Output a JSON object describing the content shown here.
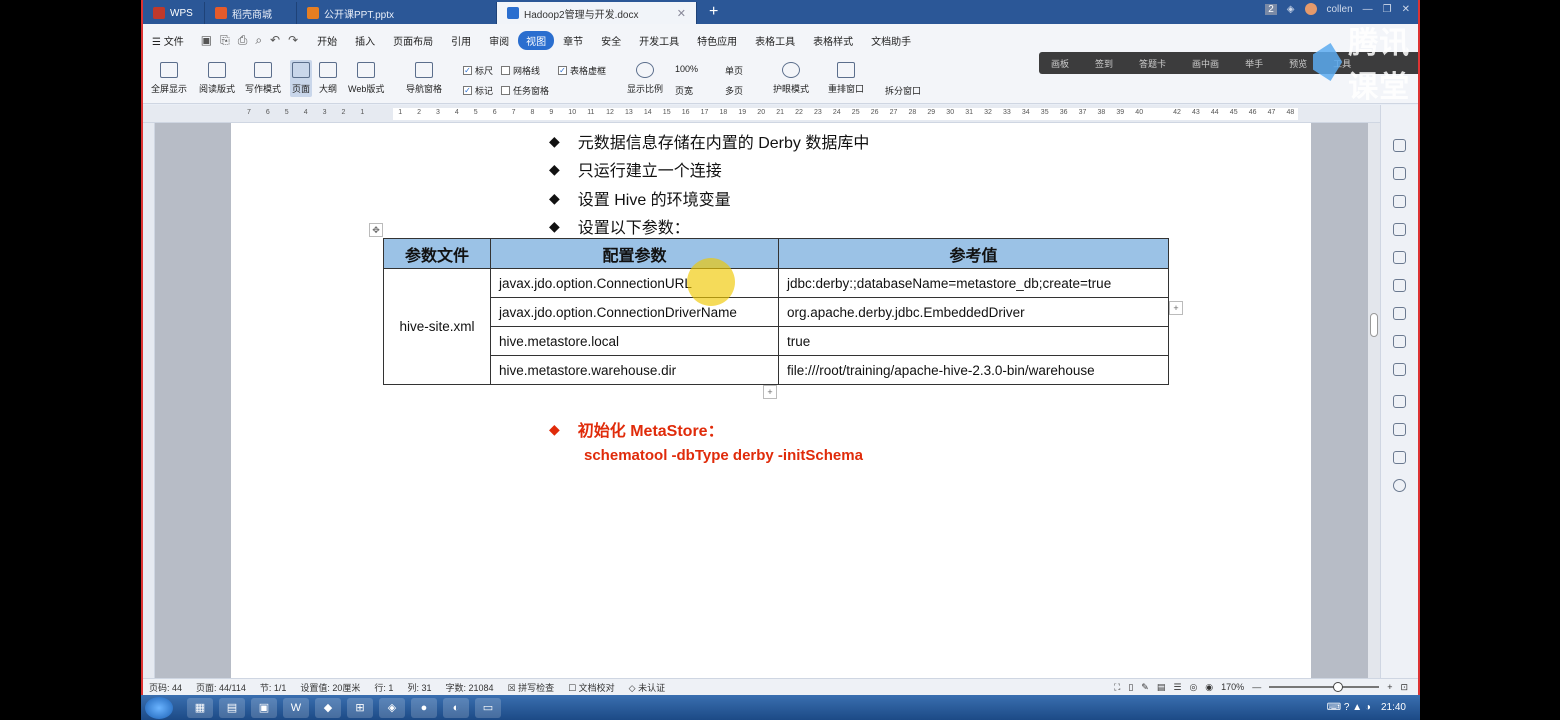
{
  "tabs": [
    {
      "label": "WPS",
      "color": "#c0392b"
    },
    {
      "label": "稻壳商城",
      "color": "#e55b2b"
    },
    {
      "label": "公开课PPT.pptx",
      "color": "#e67e22"
    },
    {
      "label": "Hadoop2管理与开发.docx",
      "color": "#2a6ecf"
    }
  ],
  "titlebar": {
    "badge": "2",
    "user": "collen"
  },
  "menu": {
    "file": "文件",
    "items": [
      "开始",
      "插入",
      "页面布局",
      "引用",
      "审阅",
      "视图",
      "章节",
      "安全",
      "开发工具",
      "特色应用",
      "表格工具",
      "表格样式",
      "文档助手"
    ],
    "selected": "视图"
  },
  "ribbon": {
    "buttons": [
      "全屏显示",
      "阅读版式",
      "写作模式",
      "页面",
      "大纲",
      "Web版式",
      "导航窗格",
      "显示比例",
      "护眼模式",
      "重排窗口",
      "拆分窗口"
    ],
    "checks": [
      {
        "label": "标尺",
        "checked": true
      },
      {
        "label": "网格线",
        "checked": false
      },
      {
        "label": "表格虚框",
        "checked": true
      },
      {
        "label": "标记",
        "checked": true
      },
      {
        "label": "任务窗格",
        "checked": false
      }
    ],
    "zoom100": "100%",
    "single": "单页",
    "pagewidth": "页宽",
    "multi": "多页"
  },
  "overlay": [
    "画板",
    "签到",
    "答题卡",
    "画中画",
    "举手",
    "预览",
    "工具"
  ],
  "brand": "腾讯课堂",
  "ruler_numbers": [
    "7",
    "6",
    "5",
    "4",
    "3",
    "2",
    "1",
    "",
    "1",
    "2",
    "3",
    "4",
    "5",
    "6",
    "7",
    "8",
    "9",
    "10",
    "11",
    "12",
    "13",
    "14",
    "15",
    "16",
    "17",
    "18",
    "19",
    "20",
    "21",
    "22",
    "23",
    "24",
    "25",
    "26",
    "27",
    "28",
    "29",
    "30",
    "31",
    "32",
    "33",
    "34",
    "35",
    "36",
    "37",
    "38",
    "39",
    "40",
    "",
    "42",
    "43",
    "44",
    "45",
    "46",
    "47",
    "48"
  ],
  "doc": {
    "bullets": [
      "元数据信息存储在内置的 Derby 数据库中",
      "只运行建立一个连接",
      "设置 Hive 的环境变量",
      "设置以下参数："
    ],
    "table": {
      "headers": [
        "参数文件",
        "配置参数",
        "参考值"
      ],
      "file": "hive-site.xml",
      "rows": [
        {
          "param": "javax.jdo.option.ConnectionURL",
          "value": "jdbc:derby:;databaseName=metastore_db;create=true"
        },
        {
          "param": "javax.jdo.option.ConnectionDriverName",
          "value": "org.apache.derby.jdbc.EmbeddedDriver"
        },
        {
          "param": "hive.metastore.local",
          "value": "true"
        },
        {
          "param": "hive.metastore.warehouse.dir",
          "value": "file:///root/training/apache-hive-2.3.0-bin/warehouse"
        }
      ]
    },
    "init_title": "初始化 MetaStore：",
    "init_cmd": "schematool -dbType derby -initSchema"
  },
  "status": {
    "pages": "页码: 44",
    "pagecount": "页面: 44/114",
    "section": "节: 1/1",
    "setting": "设置值: 20厘米",
    "row": "行: 1",
    "col": "列: 31",
    "words": "字数: 21084",
    "spell": "拼写检查",
    "proof": "文档校对",
    "cert": "未认证",
    "zoom": "170%"
  },
  "clock": "21:40"
}
